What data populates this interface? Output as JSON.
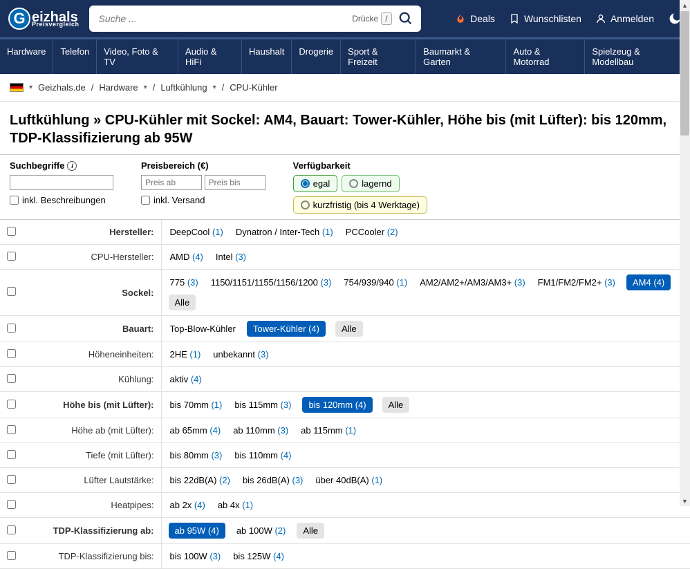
{
  "header": {
    "logo": "eizhals",
    "logo_sub": "Preisvergleich",
    "search_placeholder": "Suche ...",
    "kbd_label": "Drücke",
    "kbd_key": "/",
    "deals": "Deals",
    "wishlists": "Wunschlisten",
    "login": "Anmelden"
  },
  "nav": [
    "Hardware",
    "Telefon",
    "Video, Foto & TV",
    "Audio & HiFi",
    "Haushalt",
    "Drogerie",
    "Sport & Freizeit",
    "Baumarkt & Garten",
    "Auto & Motorrad",
    "Spielzeug & Modellbau"
  ],
  "breadcrumb": {
    "items": [
      "Geizhals.de",
      "Hardware",
      "Luftkühlung",
      "CPU-Kühler"
    ]
  },
  "page_title_pre": "Luftkühlung » ",
  "page_title_main": "CPU-Kühler mit Sockel: AM4, Bauart: Tower-Kühler, Höhe bis (mit Lüfter): bis 120mm, TDP-Klassifizierung ab 95W",
  "filter_bar": {
    "search_label": "Suchbegriffe",
    "incl_desc": "inkl. Beschreibungen",
    "price_label": "Preisbereich (€)",
    "price_from_ph": "Preis ab",
    "price_to_ph": "Preis bis",
    "incl_ship": "inkl. Versand",
    "avail_label": "Verfügbarkeit",
    "avail_any": "egal",
    "avail_stock": "lagernd",
    "avail_short": "kurzfristig (bis 4 Werktage)"
  },
  "rows": [
    {
      "label": "Hersteller:",
      "bold": true,
      "values": [
        {
          "t": "DeepCool",
          "c": "(1)"
        },
        {
          "t": "Dynatron / Inter-Tech",
          "c": "(1)"
        },
        {
          "t": "PCCooler",
          "c": "(2)"
        }
      ]
    },
    {
      "label": "CPU-Hersteller:",
      "values": [
        {
          "t": "AMD",
          "c": "(4)"
        },
        {
          "t": "Intel",
          "c": "(3)"
        }
      ]
    },
    {
      "label": "Sockel:",
      "bold": true,
      "values": [
        {
          "t": "775",
          "c": "(3)"
        },
        {
          "t": "1150/1151/1155/1156/1200",
          "c": "(3)"
        },
        {
          "t": "754/939/940",
          "c": "(1)"
        },
        {
          "t": "AM2/AM2+/AM3/AM3+",
          "c": "(3)"
        },
        {
          "t": "FM1/FM2/FM2+",
          "c": "(3)"
        },
        {
          "t": "AM4",
          "c": "(4)",
          "sel": true
        },
        {
          "t": "Alle",
          "all": true
        }
      ]
    },
    {
      "label": "Bauart:",
      "bold": true,
      "values": [
        {
          "t": "Top-Blow-Kühler"
        },
        {
          "t": "Tower-Kühler",
          "c": "(4)",
          "sel": true
        },
        {
          "t": "Alle",
          "all": true
        }
      ]
    },
    {
      "label": "Höheneinheiten:",
      "values": [
        {
          "t": "2HE",
          "c": "(1)"
        },
        {
          "t": "unbekannt",
          "c": "(3)"
        }
      ]
    },
    {
      "label": "Kühlung:",
      "values": [
        {
          "t": "aktiv",
          "c": "(4)"
        }
      ]
    },
    {
      "label": "Höhe bis (mit Lüfter):",
      "bold": true,
      "values": [
        {
          "t": "bis 70mm",
          "c": "(1)"
        },
        {
          "t": "bis 115mm",
          "c": "(3)"
        },
        {
          "t": "bis 120mm",
          "c": "(4)",
          "sel": true
        },
        {
          "t": "Alle",
          "all": true
        }
      ]
    },
    {
      "label": "Höhe ab (mit Lüfter):",
      "values": [
        {
          "t": "ab 65mm",
          "c": "(4)"
        },
        {
          "t": "ab 110mm",
          "c": "(3)"
        },
        {
          "t": "ab 115mm",
          "c": "(1)"
        }
      ]
    },
    {
      "label": "Tiefe (mit Lüfter):",
      "values": [
        {
          "t": "bis 80mm",
          "c": "(3)"
        },
        {
          "t": "bis 110mm",
          "c": "(4)"
        }
      ]
    },
    {
      "label": "Lüfter Lautstärke:",
      "values": [
        {
          "t": "bis 22dB(A)",
          "c": "(2)"
        },
        {
          "t": "bis 26dB(A)",
          "c": "(3)"
        },
        {
          "t": "über 40dB(A)",
          "c": "(1)"
        }
      ]
    },
    {
      "label": "Heatpipes:",
      "values": [
        {
          "t": "ab 2x",
          "c": "(4)"
        },
        {
          "t": "ab 4x",
          "c": "(1)"
        }
      ]
    },
    {
      "label": "TDP-Klassifizierung ab:",
      "bold": true,
      "values": [
        {
          "t": "ab 95W",
          "c": "(4)",
          "sel": true
        },
        {
          "t": "ab 100W",
          "c": "(2)"
        },
        {
          "t": "Alle",
          "all": true
        }
      ]
    },
    {
      "label": "TDP-Klassifizierung bis:",
      "values": [
        {
          "t": "bis 100W",
          "c": "(3)"
        },
        {
          "t": "bis 125W",
          "c": "(4)"
        }
      ]
    }
  ]
}
